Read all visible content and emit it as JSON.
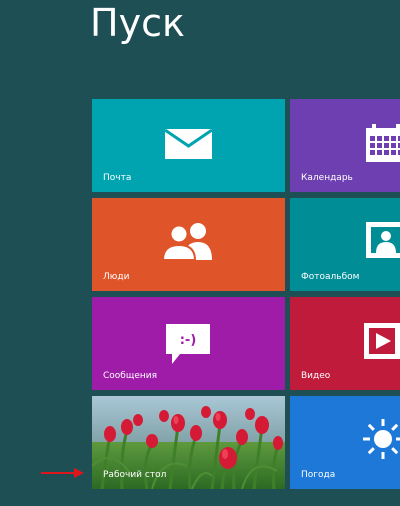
{
  "start": {
    "title": "Пуск"
  },
  "tiles": {
    "mail": {
      "label": "Почта",
      "color": "#00a3b0",
      "icon": "envelope-icon"
    },
    "calendar": {
      "label": "Календарь",
      "color": "#6e3fb0",
      "icon": "calendar-icon"
    },
    "people": {
      "label": "Люди",
      "color": "#e0542a",
      "icon": "people-icon"
    },
    "photos": {
      "label": "Фотоальбом",
      "color": "#008d96",
      "icon": "photo-icon"
    },
    "messaging": {
      "label": "Сообщения",
      "color": "#9f1ca8",
      "icon": "speech-bubble-icon"
    },
    "video": {
      "label": "Видео",
      "color": "#c11b3c",
      "icon": "play-icon"
    },
    "desktop": {
      "label": "Рабочий стол",
      "icon": "tulips-photo"
    },
    "weather": {
      "label": "Погода",
      "color": "#1e78d8",
      "icon": "sun-icon"
    }
  },
  "colors": {
    "background": "#1d4f54",
    "arrow": "#e0161f"
  }
}
